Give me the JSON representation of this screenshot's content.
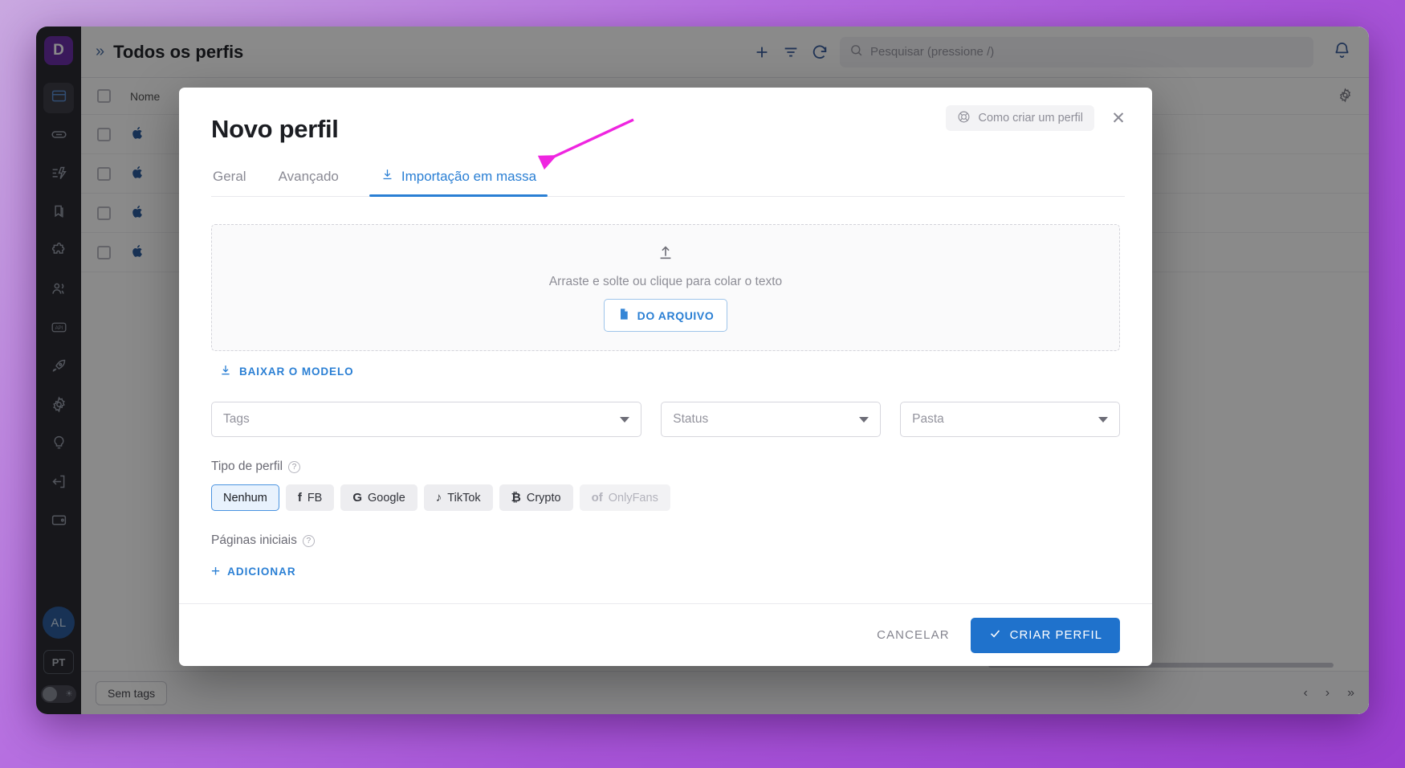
{
  "app": {
    "logo_text": "D",
    "topbar": {
      "collapse_icon": "chevrons-right-icon",
      "title": "Todos os perfis",
      "add_icon": "plus-icon",
      "filter_icon": "filter-icon",
      "refresh_icon": "refresh-icon",
      "search_placeholder": "Pesquisar (pressione /)",
      "search_icon": "search-icon",
      "bell_icon": "bell-icon"
    },
    "sidebar": {
      "items": [
        {
          "name": "sidebar-item-profiles",
          "icon": "browser-window-icon",
          "active": true
        },
        {
          "name": "sidebar-item-proxies",
          "icon": "link-icon",
          "active": false
        },
        {
          "name": "sidebar-item-automation",
          "icon": "automation-icon",
          "active": false
        },
        {
          "name": "sidebar-item-bookmarks",
          "icon": "bookmarks-icon",
          "active": false
        },
        {
          "name": "sidebar-item-extensions",
          "icon": "puzzle-icon",
          "active": false
        },
        {
          "name": "sidebar-item-team",
          "icon": "users-icon",
          "active": false
        },
        {
          "name": "sidebar-item-api",
          "icon": "api-icon",
          "active": false
        },
        {
          "name": "sidebar-item-updates",
          "icon": "rocket-icon",
          "active": false
        },
        {
          "name": "sidebar-item-settings",
          "icon": "gear-icon",
          "active": false
        },
        {
          "name": "sidebar-item-tips",
          "icon": "lightbulb-icon",
          "active": false
        },
        {
          "name": "sidebar-item-logout",
          "icon": "logout-icon",
          "active": false
        },
        {
          "name": "sidebar-item-billing",
          "icon": "wallet-icon",
          "active": false
        }
      ],
      "avatar_initials": "AL",
      "language": "PT",
      "theme_icon": "sun-icon"
    },
    "table": {
      "columns": [
        "Nome"
      ],
      "rows": [
        {
          "platform_icon": "apple-icon"
        },
        {
          "platform_icon": "apple-icon"
        },
        {
          "platform_icon": "apple-icon"
        },
        {
          "platform_icon": "apple-icon"
        }
      ],
      "settings_icon": "gear-icon"
    },
    "footer": {
      "tag_filter": "Sem tags",
      "prev_icon": "chevron-left-icon",
      "next_icon": "chevron-right-icon",
      "last_icon": "chevrons-right-icon"
    }
  },
  "modal": {
    "title": "Novo perfil",
    "help_chip": {
      "label": "Como criar um perfil",
      "icon": "lifebuoy-icon"
    },
    "close_icon": "close-icon",
    "tabs": [
      {
        "label": "Geral",
        "active": false,
        "icon": null
      },
      {
        "label": "Avançado",
        "active": false,
        "icon": null
      },
      {
        "label": "Importação em massa",
        "active": true,
        "icon": "download-icon"
      }
    ],
    "dropzone": {
      "icon": "upload-icon",
      "text": "Arraste e solte ou clique para colar o texto",
      "file_button": {
        "label": "DO ARQUIVO",
        "icon": "file-icon"
      }
    },
    "download_template": {
      "label": "BAIXAR O MODELO",
      "icon": "download-icon"
    },
    "selects": [
      {
        "name": "tags-select",
        "placeholder": "Tags",
        "value": ""
      },
      {
        "name": "status-select",
        "placeholder": "Status",
        "value": ""
      },
      {
        "name": "folder-select",
        "placeholder": "Pasta",
        "value": ""
      }
    ],
    "profile_type": {
      "label": "Tipo de perfil",
      "help_icon": "question-icon",
      "chips": [
        {
          "label": "Nenhum",
          "glyph": "",
          "selected": true,
          "disabled": false
        },
        {
          "label": "FB",
          "glyph": "f",
          "selected": false,
          "disabled": false
        },
        {
          "label": "Google",
          "glyph": "G",
          "selected": false,
          "disabled": false
        },
        {
          "label": "TikTok",
          "glyph": "♪",
          "selected": false,
          "disabled": false
        },
        {
          "label": "Crypto",
          "glyph": "₿",
          "selected": false,
          "disabled": false
        },
        {
          "label": "OnlyFans",
          "glyph": "of",
          "selected": false,
          "disabled": true
        }
      ]
    },
    "start_pages": {
      "label": "Páginas iniciais",
      "help_icon": "question-icon",
      "add_label": "ADICIONAR",
      "add_icon": "plus-icon"
    },
    "footer": {
      "cancel_label": "CANCELAR",
      "create_label": "CRIAR PERFIL",
      "create_icon": "check-icon"
    }
  },
  "annotation": {
    "arrow_color": "#ef25e0"
  }
}
